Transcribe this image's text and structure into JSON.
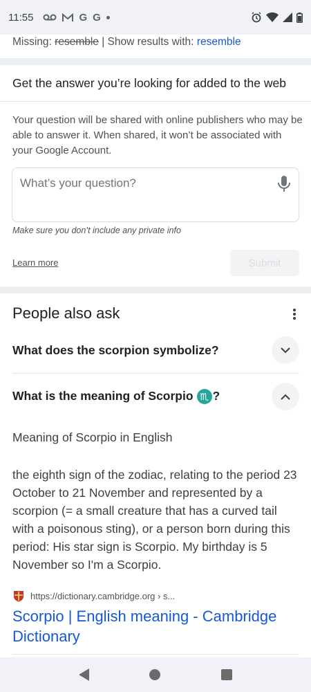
{
  "status_bar": {
    "time": "11:55",
    "left_icons": [
      "voicemail-icon",
      "gmail-icon",
      "google-icon",
      "google-icon",
      "dot-icon"
    ],
    "right_icons": [
      "alarm-icon",
      "wifi-icon",
      "signal-icon",
      "battery-icon"
    ]
  },
  "spelling": {
    "missing_label": "Missing:",
    "missing_word": "resemble",
    "separator": "|",
    "show_label": "Show results with:",
    "show_word": "resemble"
  },
  "ask_card": {
    "title": "Get the answer you’re looking for added to the web",
    "description": "Your question will be shared with online publishers who may be able to answer it. When shared, it won’t be associated with your Google Account.",
    "input_placeholder": "What’s your question?",
    "private_note": "Make sure you don’t include any private info",
    "learn_more": "Learn more",
    "submit": "Submit"
  },
  "people_also_ask": {
    "title": "People also ask",
    "questions": [
      {
        "text": "What does the scorpion symbolize?",
        "expanded": false
      },
      {
        "text": "What is the meaning of Scorpio",
        "symbol": "♏",
        "suffix": "?",
        "expanded": true
      }
    ],
    "answer": {
      "heading": "Meaning of Scorpio in English",
      "body": "the eighth sign of the zodiac, relating to the period 23 October to 21 November and represented by a scorpion (= a small creature that has a curved tail with a poisonous sting), or a person born during this period: His star sign is Scorpio. My birthday is 5 November so I'm a Scorpio.",
      "source_url": "https://dictionary.cambridge.org › s...",
      "result_title": "Scorpio | English meaning - Cambridge Dictionary"
    }
  },
  "colors": {
    "link": "#1558d6",
    "zodiac_badge": "#26a69a",
    "band": "#eceff1"
  }
}
